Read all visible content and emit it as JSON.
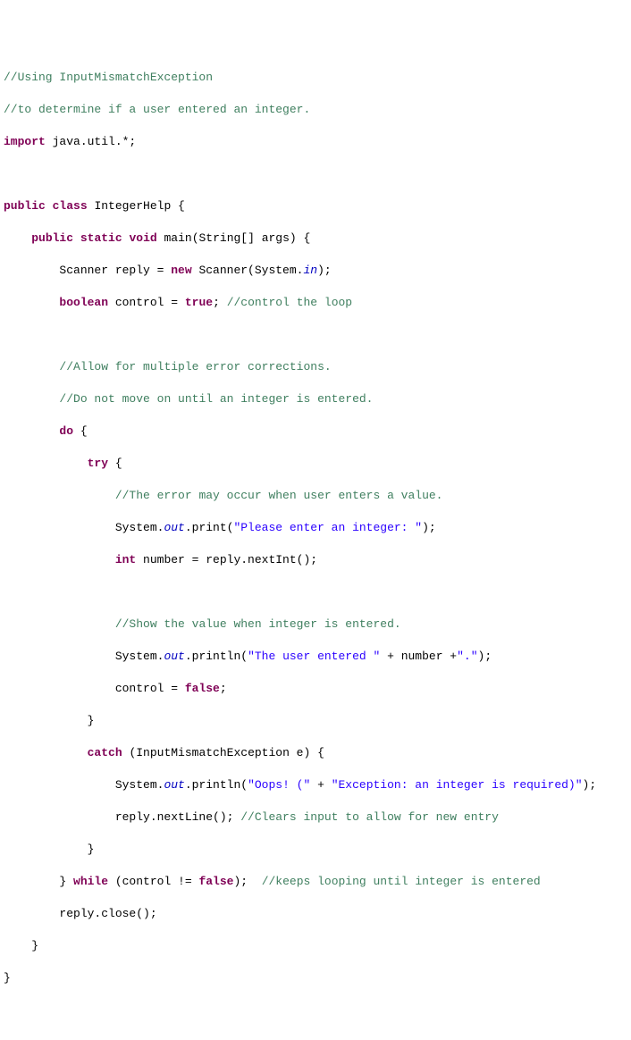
{
  "lines": {
    "l1": "//Using InputMismatchException",
    "l2": "//to determine if a user entered an integer.",
    "l3a": "import",
    "l3b": " java.util.*;",
    "l5a": "public",
    "l5b": " ",
    "l5c": "class",
    "l5d": " IntegerHelp {",
    "l6a": "    ",
    "l6b": "public",
    "l6c": " ",
    "l6d": "static",
    "l6e": " ",
    "l6f": "void",
    "l6g": " main(String[] args) {",
    "l7a": "        Scanner reply = ",
    "l7b": "new",
    "l7c": " Scanner(System.",
    "l7d": "in",
    "l7e": ");",
    "l8a": "        ",
    "l8b": "boolean",
    "l8c": " control = ",
    "l8d": "true",
    "l8e": "; ",
    "l8f": "//control the loop",
    "l10a": "        ",
    "l10b": "//Allow for multiple error corrections.",
    "l11a": "        ",
    "l11b": "//Do not move on until an integer is entered.",
    "l12a": "        ",
    "l12b": "do",
    "l12c": " {",
    "l13a": "            ",
    "l13b": "try",
    "l13c": " {",
    "l14a": "                ",
    "l14b": "//The error may occur when user enters a value.",
    "l15a": "                System.",
    "l15b": "out",
    "l15c": ".print(",
    "l15d": "\"Please enter an integer: \"",
    "l15e": ");",
    "l16a": "                ",
    "l16b": "int",
    "l16c": " number = reply.nextInt();",
    "l18a": "                ",
    "l18b": "//Show the value when integer is entered.",
    "l19a": "                System.",
    "l19b": "out",
    "l19c": ".println(",
    "l19d": "\"The user entered \"",
    "l19e": " + number +",
    "l19f": "\".\"",
    "l19g": ");",
    "l20a": "                control = ",
    "l20b": "false",
    "l20c": ";",
    "l21a": "            }",
    "l22a": "            ",
    "l22b": "catch",
    "l22c": " (InputMismatchException e) {",
    "l23a": "                System.",
    "l23b": "out",
    "l23c": ".println(",
    "l23d": "\"Oops! (\"",
    "l23e": " + ",
    "l23f": "\"Exception: an integer is required)\"",
    "l23g": ");",
    "l24a": "                reply.nextLine(); ",
    "l24b": "//Clears input to allow for new entry",
    "l25a": "            }",
    "l26a": "        } ",
    "l26b": "while",
    "l26c": " (control != ",
    "l26d": "false",
    "l26e": ");  ",
    "l26f": "//keeps looping until integer is entered",
    "l27a": "        reply.close();",
    "l28a": "    }",
    "l29a": "}"
  }
}
